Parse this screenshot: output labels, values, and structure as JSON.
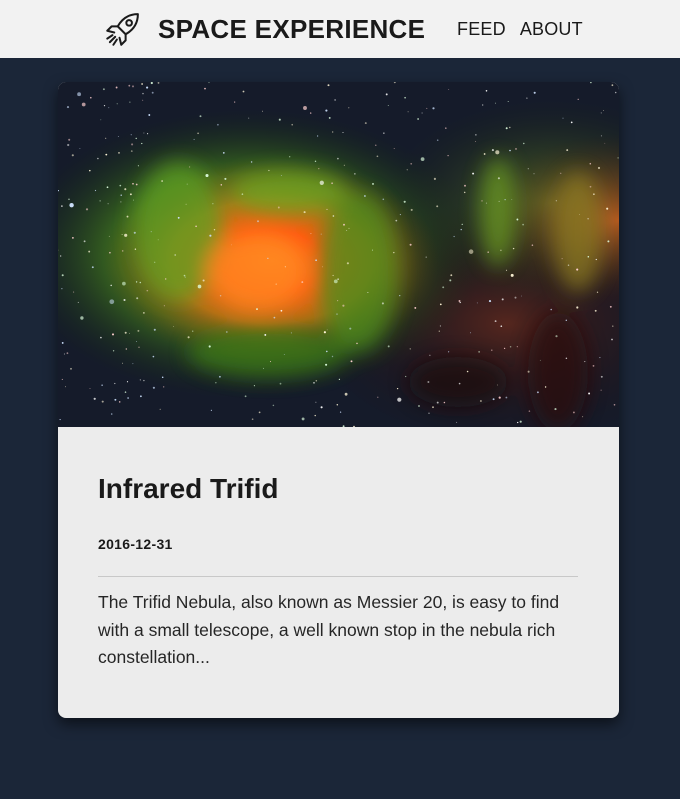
{
  "header": {
    "brand": "SPACE EXPERIENCE",
    "logo_icon": "rocket-icon",
    "nav": [
      {
        "label": "FEED"
      },
      {
        "label": "ABOUT"
      }
    ]
  },
  "post": {
    "image_icon": "nebula-image",
    "title": "Infrared Trifid",
    "date": "2016-12-31",
    "excerpt": "The Trifid Nebula, also known as Messier 20, is easy to find with a small telescope, a well known stop in the nebula rich constellation..."
  },
  "colors": {
    "background": "#1b2638",
    "header": "#f2f2f2",
    "card": "#ececec",
    "text": "#1a1a1a"
  }
}
